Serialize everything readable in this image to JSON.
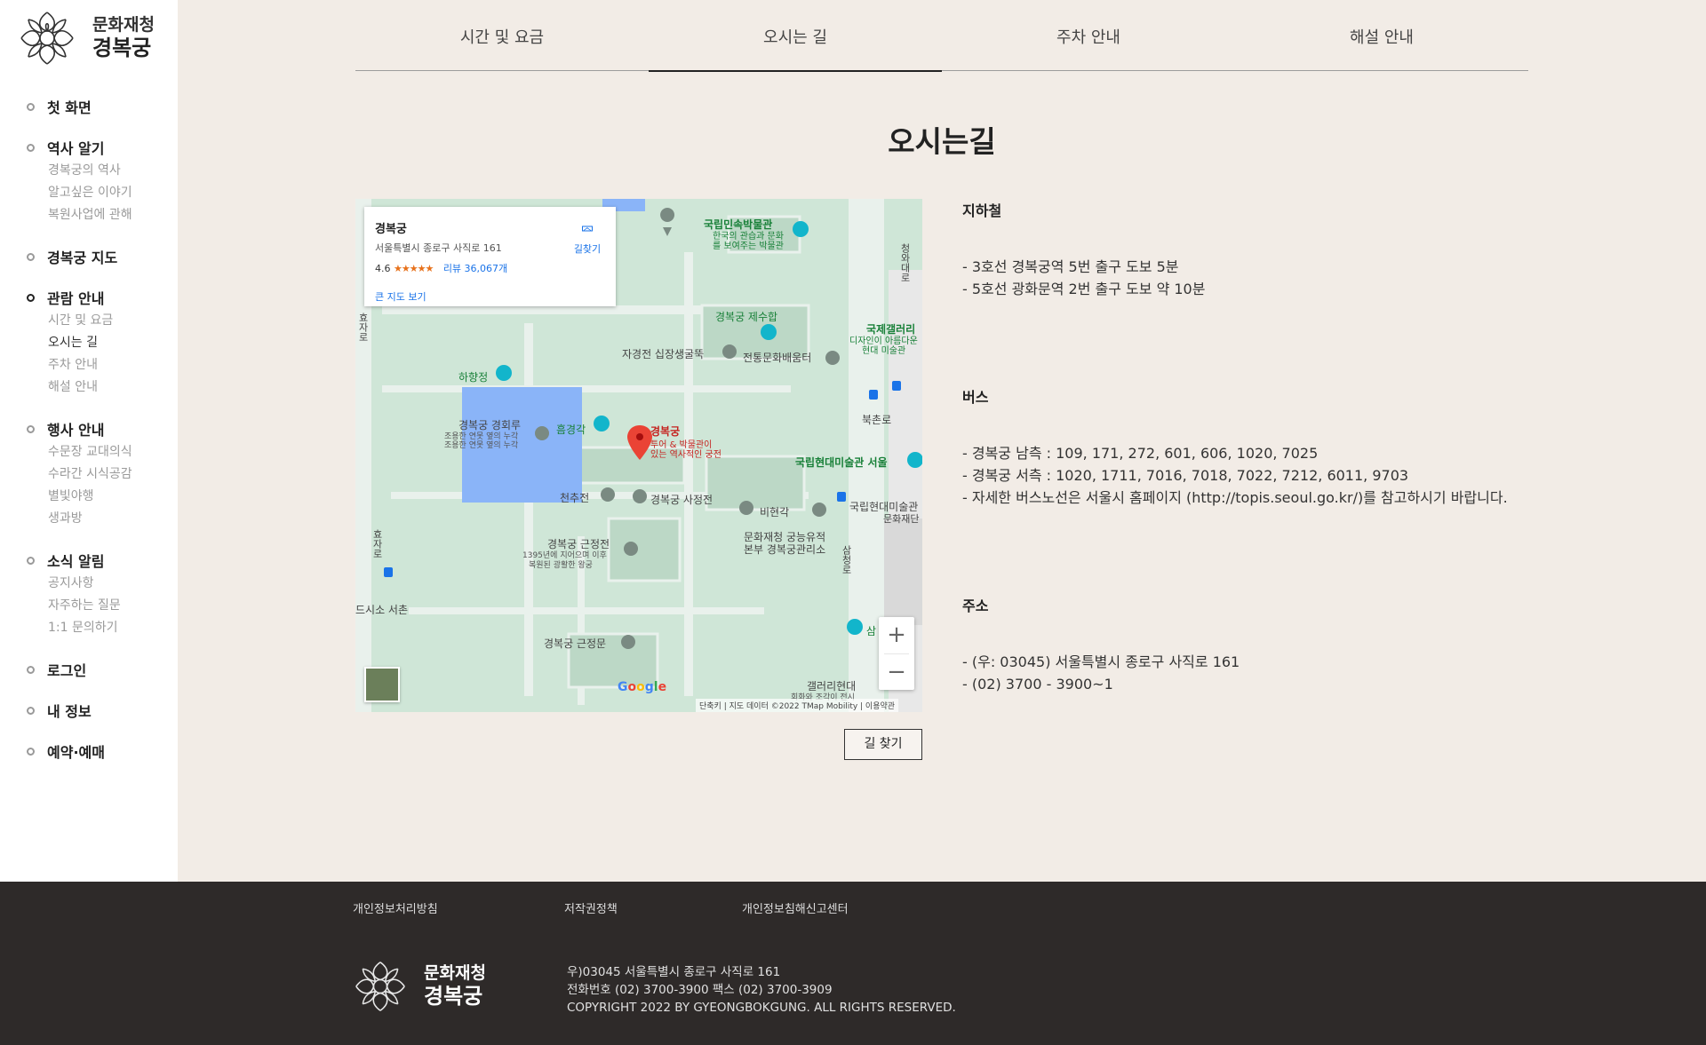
{
  "brand": {
    "line1": "문화재청",
    "line2": "경복궁"
  },
  "sidebar": {
    "groups": [
      {
        "label": "첫 화면",
        "subs": []
      },
      {
        "label": "역사 알기",
        "subs": [
          "경복궁의 역사",
          "알고싶은 이야기",
          "복원사업에 관해"
        ]
      },
      {
        "label": "경복궁 지도",
        "subs": []
      },
      {
        "label": "관람 안내",
        "subs": [
          "시간 및 요금",
          "오시는 길",
          "주차 안내",
          "해설 안내"
        ]
      },
      {
        "label": "행사 안내",
        "subs": [
          "수문장 교대의식",
          "수라간 시식공감",
          "별빛야행",
          "생과방"
        ]
      },
      {
        "label": "소식 알림",
        "subs": [
          "공지사항",
          "자주하는 질문",
          "1:1 문의하기"
        ]
      },
      {
        "label": "로그인",
        "subs": []
      },
      {
        "label": "내 정보",
        "subs": []
      },
      {
        "label": "예약·예매",
        "subs": []
      }
    ]
  },
  "tabs": [
    "시간 및 요금",
    "오시는 길",
    "주차 안내",
    "해설 안내"
  ],
  "page_title": "오시는길",
  "map": {
    "place_name": "경복궁",
    "address": "서울특별시 종로구 사직로 161",
    "rating": "4.6",
    "stars": "★★★★★",
    "reviews": "리뷰 36,067개",
    "directions": "길찾기",
    "large_map": "큰 지도 보기",
    "zoom_in": "+",
    "zoom_out": "−",
    "google": [
      "G",
      "o",
      "o",
      "g",
      "l",
      "e"
    ],
    "footer": "단축키  |  지도 데이터 ©2022 TMap Mobility  |  이용약관",
    "labels": {
      "folk_museum": "국립민속박물관",
      "folk_museum_sub1": "한국의 관습과 문화",
      "folk_museum_sub2": "를 보여주는 박물관",
      "jesuhap": "경복궁 제수합",
      "intl_gallery": "국제갤러리",
      "intl_gallery_sub1": "디자인이 아름다운",
      "intl_gallery_sub2": "현대 미술관",
      "jagyeongjeon": "자경전 십장생굴뚝",
      "traditional": "전통문화배움터",
      "hyangwonjeong": "하향정",
      "gyeonghoeru": "경복궁 경회루",
      "gyeonghoeru_sub1": "조용한 연못 옆의 누각",
      "gyeonghoeru_sub2": "조용한 연못 옆의 누각",
      "heumgyeonggak": "흠경각",
      "main_pin": "경복궁",
      "main_pin_sub1": "투어 & 박물관이",
      "main_pin_sub2": "있는 역사적인 궁전",
      "mmca": "국립현대미술관 서울",
      "cheonchujeon": "천추전",
      "sajeongjeon": "경복궁 사정전",
      "bihyeongak": "비현각",
      "mmca2": "국립현대미술관",
      "mmca2_sub": "문화재단",
      "geunjeongjeon": "경복궁 근정전",
      "geunjeongjeon_sub1": "1395년에 지어으며 이후",
      "geunjeongjeon_sub2": "복원된 광활한 왕궁",
      "palace_office1": "문화재청 궁능유적",
      "palace_office2": "본부 경복궁관리소",
      "bukchon": "북촌로",
      "hyoja": "효자로",
      "seochon": "드시소 서촌",
      "geunjeongmun": "경복궁 근정문",
      "gallery_hyundai": "갤러리현대",
      "gallery_hyundai_sub": "회화와 조각이 전시",
      "samcheong": "삼",
      "jahamun": "효자로",
      "cheongwadae": "청와대로",
      "samcheongro": "삼청로"
    }
  },
  "find_button": "길 찾기",
  "info": {
    "subway": {
      "title": "지하철",
      "lines": [
        "- 3호선 경복궁역 5번 출구 도보 5분",
        "- 5호선 광화문역 2번 출구 도보 약 10분"
      ]
    },
    "bus": {
      "title": "버스",
      "lines": [
        "- 경복궁 남측 : 109, 171, 272, 601, 606, 1020, 7025",
        "- 경복궁 서측 : 1020, 1711, 7016, 7018, 7022, 7212, 6011, 9703",
        "- 자세한 버스노선은 서울시 홈페이지 (http://topis.seoul.go.kr/)를 참고하시기 바랍니다."
      ]
    },
    "address": {
      "title": "주소",
      "lines": [
        "- (우: 03045) 서울특별시 종로구 사직로 161",
        "- (02) 3700 - 3900~1"
      ]
    }
  },
  "footer": {
    "links": [
      "개인정보처리방침",
      "저작권정책",
      "개인정보침해신고센터"
    ],
    "info": [
      "우)03045 서울특별시 종로구 사직로 161",
      "전화번호 (02) 3700-3900 팩스 (02) 3700-3909",
      "COPYRIGHT 2022 BY GYEONGBOKGUNG. ALL RIGHTS RESERVED."
    ]
  },
  "colors": {
    "background": "#f2ece6",
    "sidebar": "#ffffff",
    "footer": "#2e2a29",
    "map_green": "#cfe6d7",
    "water": "#8ab4f8",
    "pin_red": "#ea4335"
  },
  "icons": [
    "flower-logo-icon",
    "directions-icon",
    "map-pin-icon",
    "teal-pin-icon",
    "bus-stop-icon"
  ]
}
